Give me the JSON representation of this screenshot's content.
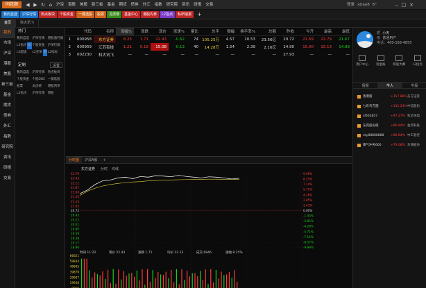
{
  "app": {
    "logo": "同花顺"
  },
  "menu": [
    "沪深",
    "港股",
    "美股",
    "新三板",
    "基金",
    "期货",
    "债券",
    "外汇",
    "指数",
    "研究院",
    "资讯",
    "研报",
    "交易"
  ],
  "title_tools": {
    "login": "登录",
    "user": "xDae8",
    "weather": "6°"
  },
  "toolbar": {
    "items": [
      {
        "label": "我的自选",
        "color": "#1a73c8"
      },
      {
        "label": "沪深行情",
        "color": "#1a73c8"
      },
      {
        "label": "热点板块",
        "color": "#c02626"
      },
      {
        "label": "个股资金",
        "color": "#c02626"
      },
      {
        "label": "一键选股",
        "color": "#d1641a"
      },
      {
        "label": "股票",
        "color": "#d1641a"
      },
      {
        "label": "龙虎榜",
        "color": "#3a8a1a"
      },
      {
        "label": "基金中心",
        "color": "#c02626"
      },
      {
        "label": "港股内参",
        "color": "#c02626"
      },
      {
        "label": "L2指点",
        "color": "#7a3ac8"
      },
      {
        "label": "私研速报",
        "color": "#c02626"
      }
    ],
    "add": "+"
  },
  "tabs": [
    "首页",
    "科大讯飞"
  ],
  "sidebar": [
    "我的",
    "市场",
    "沪深",
    "港股",
    "美股",
    "新三板",
    "基金",
    "期货",
    "债券",
    "外汇",
    "指数",
    "研究院",
    "资讯",
    "研报",
    "交易"
  ],
  "panel": {
    "hot_title": "热门",
    "hot_items": [
      "我的自选",
      "沪深行情",
      "港股通行情",
      "L2指点",
      "个股资金",
      "沪深行情",
      "L2超级",
      "L2买单",
      "L2指标"
    ],
    "hot_badges": {
      "2": "新",
      "3": "新",
      "7": "新"
    },
    "custom_title": "定制",
    "custom_btn": "设置",
    "custom_items": [
      "我的自选",
      "沪深行情",
      "热点板块",
      "个股资金",
      "个股DDE",
      "一键选股",
      "股票",
      "龙虎榜",
      "港股内参",
      "L2指点",
      "沪深行情",
      "港股"
    ]
  },
  "quote_table": {
    "headers": [
      "",
      "代码",
      "名称",
      "涨幅%",
      "涨跌",
      "现价",
      "涨速%",
      "量比",
      "总手",
      "振幅",
      "换手率%",
      "总额",
      "昨收",
      "今开",
      "最高",
      "最低"
    ],
    "rows": [
      [
        "1",
        "600958",
        "东方证券",
        "8.25",
        "1.71",
        "22.43",
        "-0.62",
        "74",
        "105.25万",
        "4.57",
        "10.53",
        "23.56亿",
        "20.72",
        "21.69",
        "22.79",
        "21.67"
      ],
      [
        "2",
        "600959",
        "江苏有线",
        "1.21",
        "0.18",
        "15.08",
        "-0.13",
        "40",
        "14.28万",
        "1.54",
        "2.39",
        "2.16亿",
        "14.90",
        "15.00",
        "15.19",
        "14.88"
      ],
      [
        "3",
        "002230",
        "科大讯飞",
        "—",
        "—",
        "—",
        "—",
        "—",
        "—",
        "—",
        "—",
        "—",
        "27.93",
        "—",
        "—",
        "—"
      ]
    ]
  },
  "chart_tabs": [
    "分时图",
    "沪深A股",
    "+"
  ],
  "chart_header": {
    "name": "东方证券",
    "code": "分时",
    "extra": "均线"
  },
  "chart_yleft": [
    "22.79",
    "22.43",
    "22.11",
    "21.87",
    "21.66",
    "21.45",
    "21.24",
    "21.02",
    "20.72",
    "20.43",
    "20.22",
    "20.01",
    "19.80",
    "19.59",
    "19.38",
    "19.17",
    "18.96"
  ],
  "chart_yright": [
    "9.99%",
    "8.25%",
    "7.14%",
    "5.71%",
    "4.28%",
    "2.85%",
    "1.43%",
    "0.00%",
    "-1.43%",
    "-2.85%",
    "-4.28%",
    "-5.71%",
    "-7.14%",
    "-8.57%",
    "-9.99%"
  ],
  "chart_status": {
    "time": "时间 11:22",
    "price": "现价 22.43",
    "change": "涨跌 1.71",
    "avg": "均价 22.13",
    "vol": "成交 6846",
    "pct": "涨幅 8.25%"
  },
  "chart_vol_labels": [
    "66621",
    "59934",
    "49845",
    "39876",
    "29907",
    "19938",
    "9969"
  ],
  "right": {
    "user_name": "小天",
    "user_role": "普通用户",
    "phone_label": "电话：",
    "phone": "400-168-4855",
    "icons": [
      "用户中心",
      "资金账",
      "积股大赛",
      "L2指点"
    ],
    "tabs": [
      "情报",
      "牛人",
      "牛股"
    ],
    "list": [
      {
        "name": "香港版",
        "pct": "+157.86%",
        "stock": "东方证券"
      },
      {
        "name": "七彩鸟方圆",
        "pct": "+131.24%",
        "stock": "中信股份"
      },
      {
        "name": "sf603857",
        "pct": "+97.27%",
        "stock": "科达洗电"
      },
      {
        "name": "东莞股份版",
        "pct": "+86.94%",
        "stock": "金风科技"
      },
      {
        "name": "sky88888888",
        "pct": "+80.64%",
        "stock": "中工智控"
      },
      {
        "name": "豪气冲天666",
        "pct": "+79.08%",
        "stock": "东海股份"
      }
    ]
  }
}
